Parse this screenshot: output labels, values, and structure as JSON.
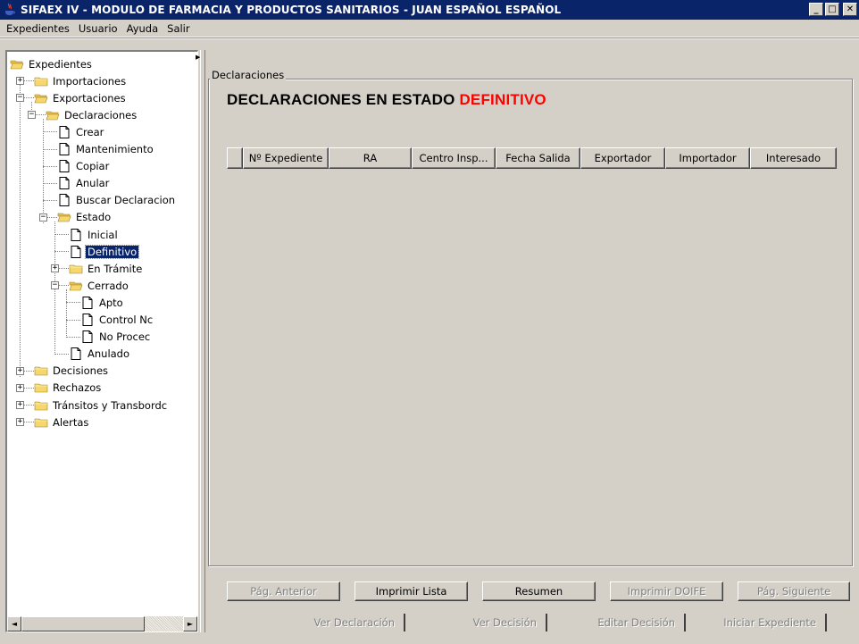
{
  "window": {
    "title": "SIFAEX IV - MODULO DE FARMACIA Y PRODUCTOS SANITARIOS - JUAN ESPAÑOL ESPAÑOL",
    "minimize": "_",
    "maximize": "□",
    "close": "✕"
  },
  "menu": {
    "items": [
      "Expedientes",
      "Usuario",
      "Ayuda",
      "Salir"
    ]
  },
  "tree": {
    "nodes": [
      {
        "label": "Expedientes",
        "icon": "folder-open-icon"
      },
      {
        "label": "Importaciones",
        "icon": "folder-icon",
        "expander": "+"
      },
      {
        "label": "Exportaciones",
        "icon": "folder-open-icon",
        "expander": "−"
      },
      {
        "label": "Declaraciones",
        "icon": "folder-open-icon",
        "expander": "−"
      },
      {
        "label": "Crear",
        "icon": "document-icon"
      },
      {
        "label": "Mantenimiento",
        "icon": "document-icon"
      },
      {
        "label": "Copiar",
        "icon": "document-icon"
      },
      {
        "label": "Anular",
        "icon": "document-icon"
      },
      {
        "label": "Buscar Declaracion",
        "icon": "document-icon"
      },
      {
        "label": "Estado",
        "icon": "folder-open-icon",
        "expander": "−"
      },
      {
        "label": "Inicial",
        "icon": "document-icon"
      },
      {
        "label": "Definitivo",
        "icon": "document-icon",
        "selected": true
      },
      {
        "label": "En Trámite",
        "icon": "folder-icon",
        "expander": "+"
      },
      {
        "label": "Cerrado",
        "icon": "folder-open-icon",
        "expander": "−"
      },
      {
        "label": "Apto",
        "icon": "document-icon"
      },
      {
        "label": "Control Nc",
        "icon": "document-icon"
      },
      {
        "label": "No Procec",
        "icon": "document-icon"
      },
      {
        "label": "Anulado",
        "icon": "document-icon"
      },
      {
        "label": "Decisiones",
        "icon": "folder-icon",
        "expander": "+"
      },
      {
        "label": "Rechazos",
        "icon": "folder-icon",
        "expander": "+"
      },
      {
        "label": "Tránsitos y Transbordc",
        "icon": "folder-icon",
        "expander": "+"
      },
      {
        "label": "Alertas",
        "icon": "folder-icon",
        "expander": "+"
      }
    ]
  },
  "scroll": {
    "left": "◄",
    "right": "►"
  },
  "panel": {
    "group_title": "Declaraciones",
    "heading_prefix": "DECLARACIONES EN ESTADO ",
    "heading_state": "DEFINITIVO",
    "columns": [
      "",
      "Nº Expediente",
      "RA",
      "Centro Insp...",
      "Fecha Salida",
      "Exportador",
      "Importador",
      "Interesado"
    ],
    "rows": []
  },
  "buttons": {
    "row1": [
      {
        "label": "Pág. Anterior",
        "enabled": false
      },
      {
        "label": "Imprimir Lista",
        "enabled": true
      },
      {
        "label": "Resumen",
        "enabled": true
      },
      {
        "label": "Imprimir DOIFE",
        "enabled": false
      },
      {
        "label": "Pág. Siguiente",
        "enabled": false
      }
    ],
    "row2": [
      {
        "label": "Ver Declaración",
        "enabled": false
      },
      {
        "label": "Ver Decisión",
        "enabled": false
      },
      {
        "label": "Editar Decisión",
        "enabled": false
      },
      {
        "label": "Iniciar Expediente",
        "enabled": false
      }
    ]
  },
  "colors": {
    "titlebar": "#0a246a",
    "face": "#d4d0c8",
    "selection": "#0a246a",
    "accent": "#ff0000",
    "folder": "#f5d76e"
  }
}
